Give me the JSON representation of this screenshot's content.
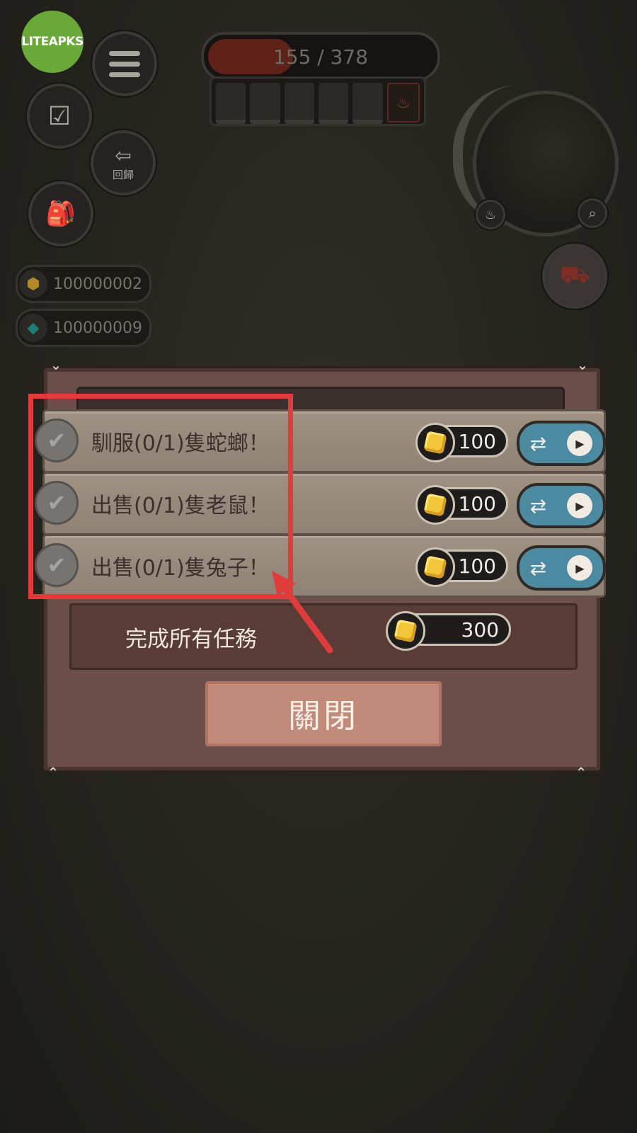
{
  "watermark": "LITEAPKS",
  "hud": {
    "hp_text": "155 / 378",
    "hp_fraction": 0.4,
    "return_label": "回歸"
  },
  "resources": [
    {
      "icon": "gold-nugget-icon",
      "value": "100000002"
    },
    {
      "icon": "emerald-icon",
      "value": "100000009"
    }
  ],
  "tasks": {
    "items": [
      {
        "label": "馴服(0/1)隻蛇螂！",
        "reward": "100"
      },
      {
        "label": "出售(0/1)隻老鼠！",
        "reward": "100"
      },
      {
        "label": "出售(0/1)隻兔子！",
        "reward": "100"
      }
    ],
    "complete_all_label": "完成所有任務",
    "complete_all_reward": "300",
    "close_label": "關閉"
  },
  "colors": {
    "annotation": "#e03c3c",
    "swap_button": "#4b8aa1",
    "close_button": "#c28a7a",
    "gold": "#f2c63a"
  }
}
